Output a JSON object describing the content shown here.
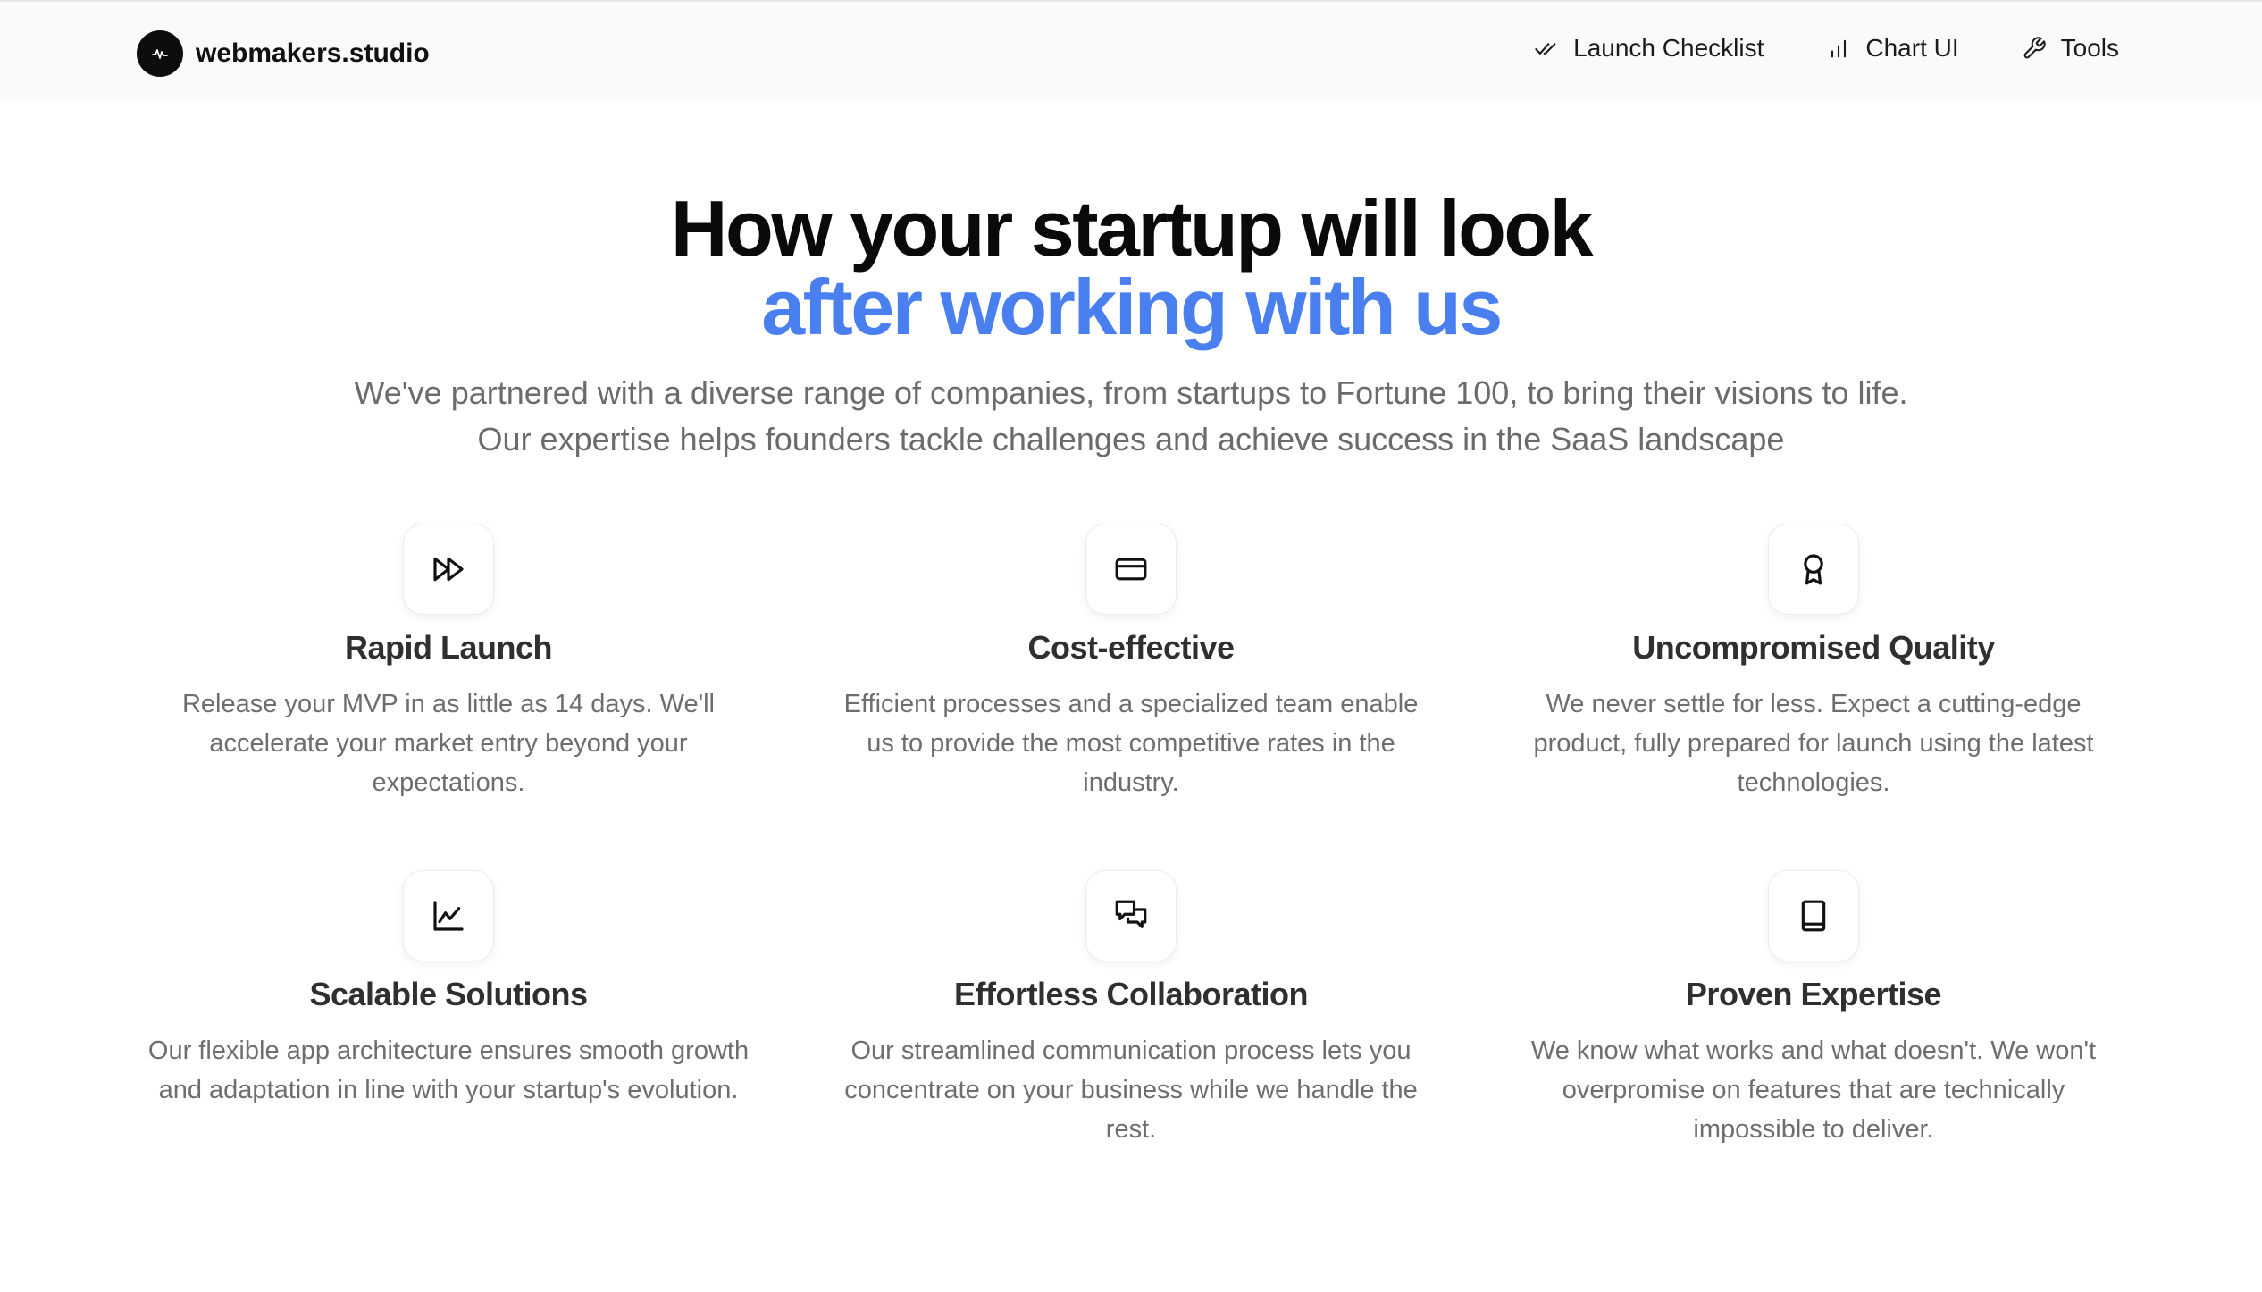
{
  "header": {
    "brand": "webmakers.studio",
    "nav": [
      {
        "label": "Launch Checklist",
        "icon": "double-check-icon"
      },
      {
        "label": "Chart UI",
        "icon": "bar-chart-icon"
      },
      {
        "label": "Tools",
        "icon": "wrench-icon"
      }
    ]
  },
  "hero": {
    "title_line1": "How your startup will look",
    "title_line2": "after working with us",
    "subtitle_line1": "We've partnered with a diverse range of companies, from startups to Fortune 100, to bring their visions to life.",
    "subtitle_line2": "Our expertise helps founders tackle challenges and achieve success in the SaaS landscape"
  },
  "colors": {
    "accent": "#4a7ff0",
    "heading": "#0a0a0a",
    "muted_text": "#6e6e6e",
    "header_bg": "#fafafa"
  },
  "features": [
    {
      "title": "Rapid Launch",
      "icon": "fast-forward-icon",
      "description": "Release your MVP in as little as 14 days. We'll accelerate your market entry beyond your expectations."
    },
    {
      "title": "Cost-effective",
      "icon": "credit-card-icon",
      "description": "Efficient processes and a specialized team enable us to provide the most competitive rates in the industry."
    },
    {
      "title": "Uncompromised Quality",
      "icon": "award-icon",
      "description": "We never settle for less. Expect a cutting-edge product, fully prepared for launch using the latest technologies."
    },
    {
      "title": "Scalable Solutions",
      "icon": "line-chart-icon",
      "description": "Our flexible app architecture ensures smooth growth and adaptation in line with your startup's evolution."
    },
    {
      "title": "Effortless Collaboration",
      "icon": "chat-bubbles-icon",
      "description": "Our streamlined communication process lets you concentrate on your business while we handle the rest."
    },
    {
      "title": "Proven Expertise",
      "icon": "book-icon",
      "description": "We know what works and what doesn't. We won't overpromise on features that are technically impossible to deliver."
    }
  ]
}
